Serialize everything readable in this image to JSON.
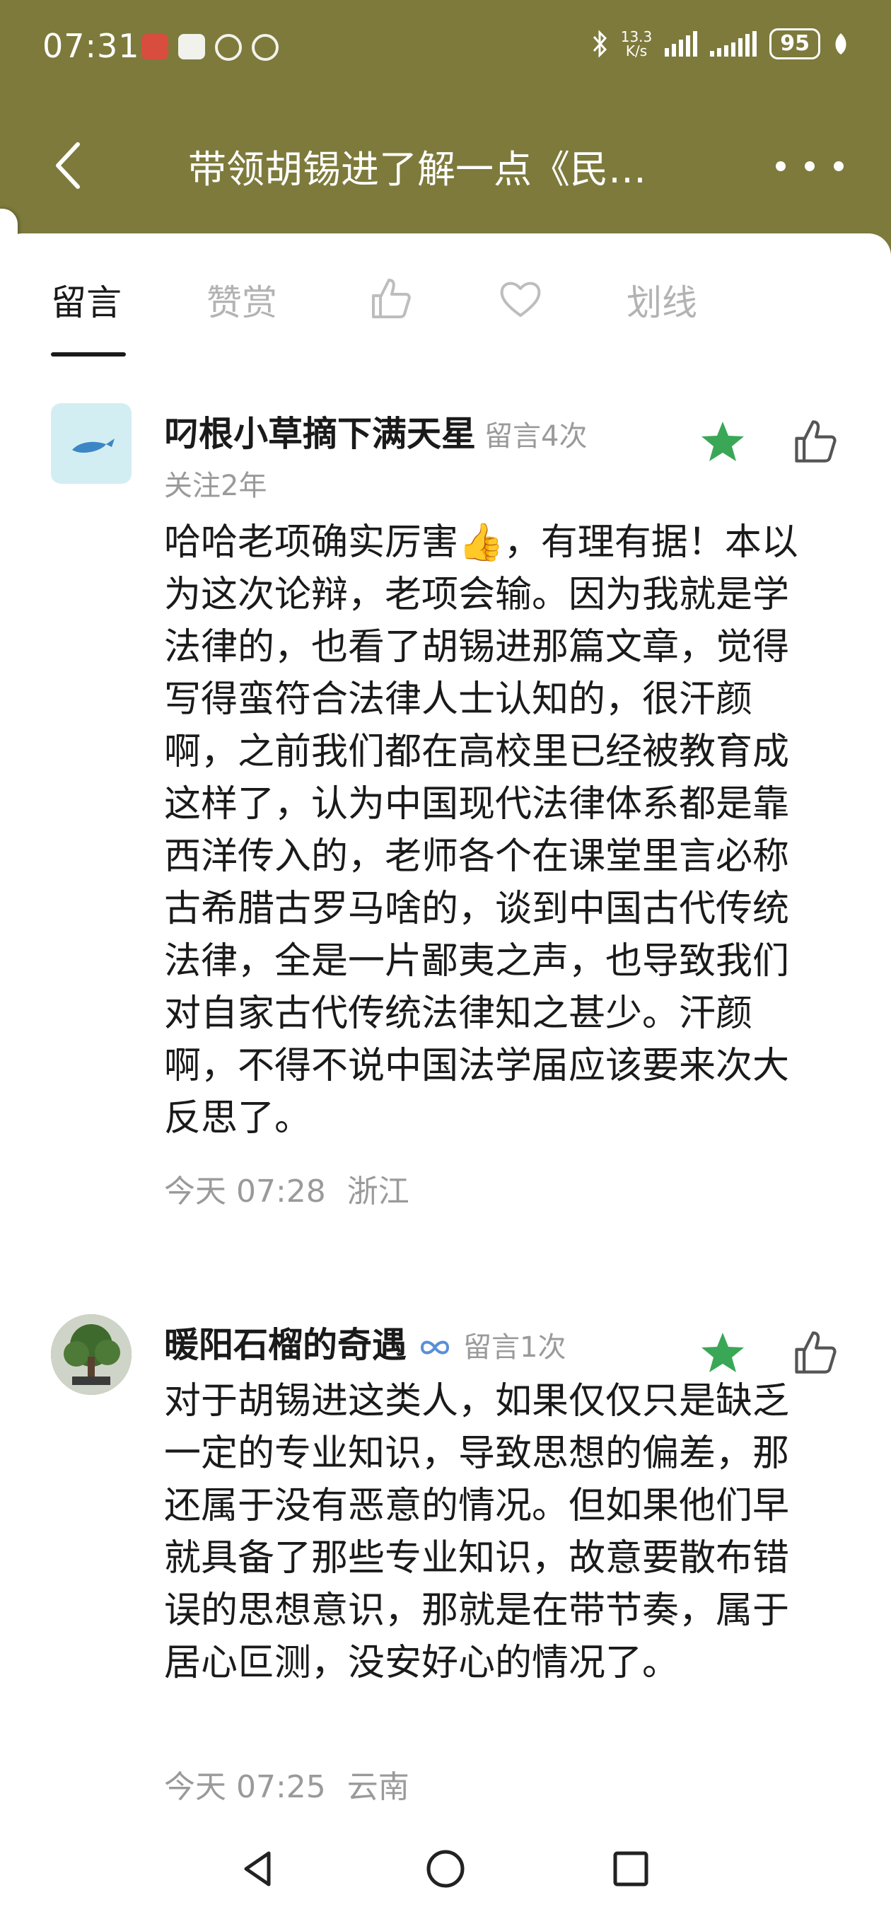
{
  "status_bar": {
    "time": "07:31",
    "speed_value": "13.3",
    "speed_unit": "K/s",
    "battery": "95"
  },
  "header": {
    "title": "带领胡锡进了解一点《民…"
  },
  "tabs": [
    {
      "label": "留言",
      "active": true
    },
    {
      "label": "赞赏",
      "active": false
    },
    {
      "icon": "thumbs-up-icon"
    },
    {
      "icon": "heart-icon"
    },
    {
      "label": "划线",
      "active": false
    }
  ],
  "comments": [
    {
      "username": "叼根小草摘下满天星",
      "message_count": "留言4次",
      "follow_duration": "关注2年",
      "text": "哈哈老项确实厉害👍，有理有据！本以为这次论辩，老项会输。因为我就是学法律的，也看了胡锡进那篇文章，觉得写得蛮符合法律人士认知的，很汗颜啊，之前我们都在高校里已经被教育成这样了，认为中国现代法律体系都是靠西洋传入的，老师各个在课堂里言必称古希腊古罗马啥的，谈到中国古代传统法律，全是一片鄙夷之声，也导致我们对自家古代传统法律知之甚少。汗颜啊，不得不说中国法学届应该要来次大反思了。",
      "time": "今天 07:28",
      "location": "浙江",
      "starred": true
    },
    {
      "username": "暖阳石榴的奇遇",
      "message_count": "留言1次",
      "text": "对于胡锡进这类人，如果仅仅只是缺乏一定的专业知识，导致思想的偏差，那还属于没有恶意的情况。但如果他们早就具备了那些专业知识，故意要散布错误的思想意识，那就是在带节奏，属于居心叵测，没安好心的情况了。",
      "time": "今天 07:25",
      "location": "云南",
      "starred": true
    }
  ],
  "colors": {
    "header_bg": "#7d7a3c",
    "star_green": "#3aa757"
  }
}
